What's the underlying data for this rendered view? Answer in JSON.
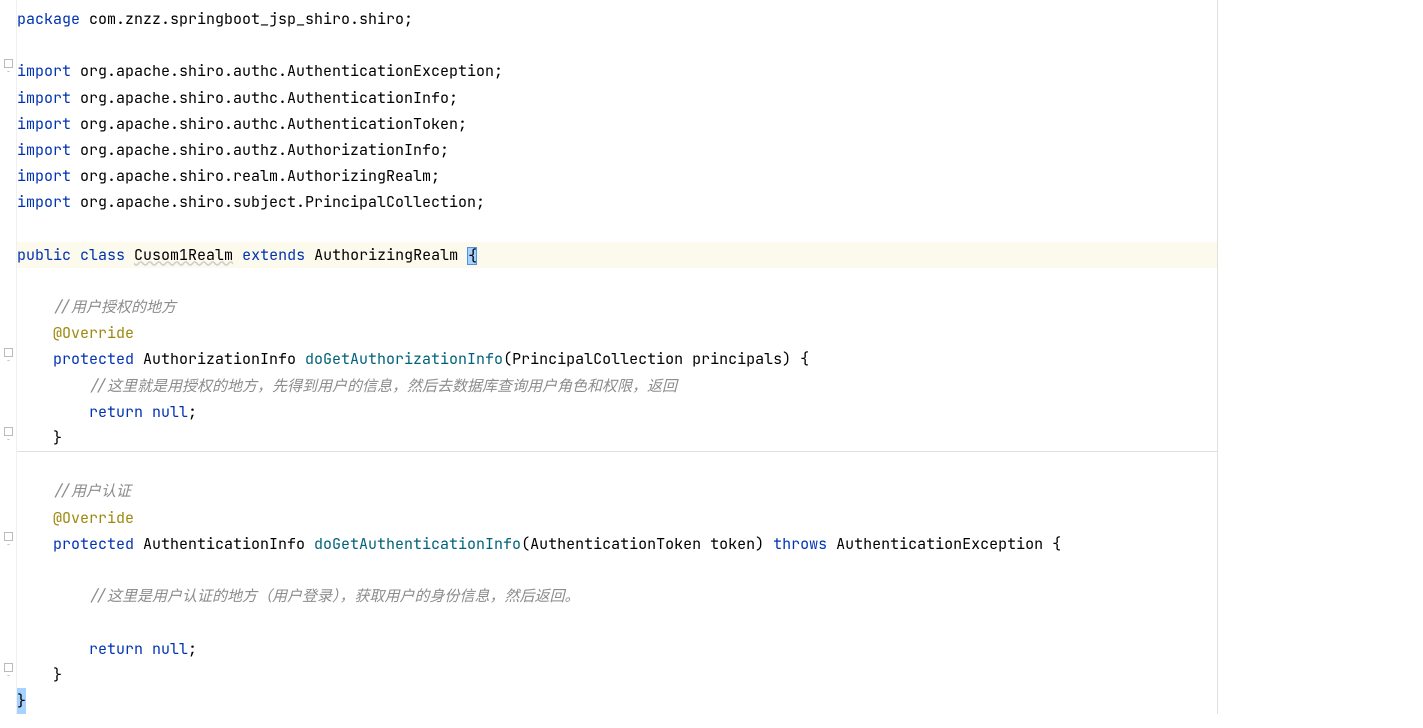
{
  "code": {
    "package_kw": "package",
    "package_name": " com.znzz.springboot_jsp_shiro.shiro;",
    "import_kw": "import",
    "imports": [
      " org.apache.shiro.authc.AuthenticationException;",
      " org.apache.shiro.authc.AuthenticationInfo;",
      " org.apache.shiro.authc.AuthenticationToken;",
      " org.apache.shiro.authz.AuthorizationInfo;",
      " org.apache.shiro.realm.AuthorizingRealm;",
      " org.apache.shiro.subject.PrincipalCollection;"
    ],
    "public_kw": "public",
    "class_kw": " class",
    "class_name": "Cusom1Realm",
    "extends_kw": "extends",
    "super_class": " AuthorizingRealm ",
    "open_brace": "{",
    "comment_auth": "//用户授权的地方",
    "override": "@Override",
    "protected_kw": "protected",
    "method1_ret": " AuthorizationInfo ",
    "method1_name": "doGetAuthorizationInfo",
    "method1_params": "(PrincipalCollection principals) {",
    "method1_comment": "//这里就是用授权的地方，先得到用户的信息，然后去数据库查询用户角色和权限，返回",
    "return_kw": "return",
    "null_kw": " null",
    "semicolon": ";",
    "close_brace": "}",
    "comment_authc": "//用户认证",
    "method2_ret": " AuthenticationInfo ",
    "method2_name": "doGetAuthenticationInfo",
    "method2_params": "(AuthenticationToken token) ",
    "throws_kw": "throws",
    "throws_type": " AuthenticationException {",
    "method2_comment": "//这里是用户认证的地方（用户登录），获取用户的身份信息，然后返回。"
  }
}
